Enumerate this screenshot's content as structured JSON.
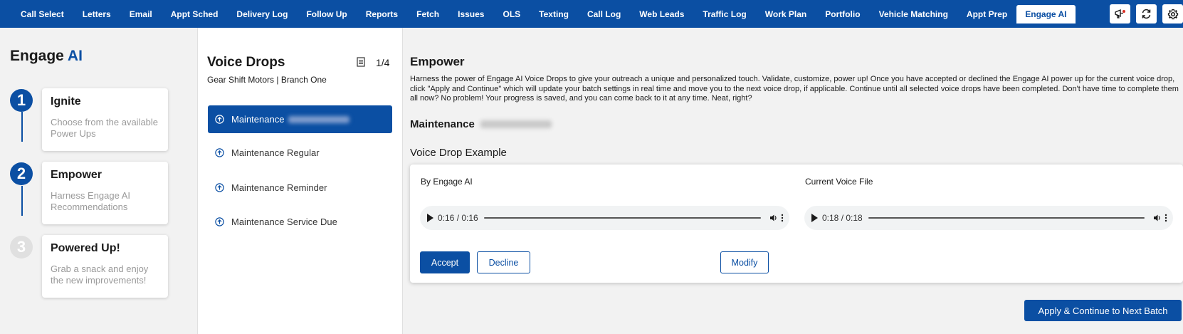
{
  "nav": {
    "tabs": [
      "Call Select",
      "Letters",
      "Email",
      "Appt Sched",
      "Delivery Log",
      "Follow Up",
      "Reports",
      "Fetch",
      "Issues",
      "OLS",
      "Texting",
      "Call Log",
      "Web Leads",
      "Traffic Log",
      "Work Plan",
      "Portfolio",
      "Vehicle Matching",
      "Appt Prep",
      "Engage AI"
    ],
    "active_tab": "Engage AI",
    "icons": [
      "megaphone-icon",
      "refresh-icon",
      "gear-icon"
    ]
  },
  "sidebar": {
    "brand_prefix": "Engage",
    "brand_suffix": "AI",
    "steps": [
      {
        "number": "1",
        "title": "Ignite",
        "description": "Choose from the available Power Ups",
        "state": "complete"
      },
      {
        "number": "2",
        "title": "Empower",
        "description": "Harness Engage AI Recommendations",
        "state": "current"
      },
      {
        "number": "3",
        "title": "Powered Up!",
        "description": "Grab a snack and enjoy the new improvements!",
        "state": "pending"
      }
    ]
  },
  "voice_drops": {
    "title": "Voice Drops",
    "count": "1/4",
    "subtitle": "Gear Shift Motors | Branch One",
    "items": [
      {
        "label": "Maintenance",
        "active": true,
        "redacted": true
      },
      {
        "label": "Maintenance Regular",
        "active": false,
        "redacted": false
      },
      {
        "label": "Maintenance Reminder",
        "active": false,
        "redacted": false
      },
      {
        "label": "Maintenance Service Due",
        "active": false,
        "redacted": false
      }
    ]
  },
  "empower": {
    "title": "Empower",
    "description": "Harness the power of Engage AI Voice Drops to give your outreach a unique and personalized touch. Validate, customize, power up! Once you have accepted or declined the Engage AI power up for the current voice drop, click \"Apply and Continue\" which will update your batch settings in real time and move you to the next voice drop, if applicable. Continue until all selected voice drops have been completed. Don't have time to complete them all now? No problem! Your progress is saved, and you can come back to it at any time. Neat, right?",
    "selected_title": "Maintenance",
    "example_title": "Voice Drop Example",
    "engage_label": "By Engage AI",
    "engage_time": "0:16 / 0:16",
    "current_label": "Current Voice File",
    "current_time": "0:18 / 0:18",
    "accept_label": "Accept",
    "decline_label": "Decline",
    "modify_label": "Modify",
    "apply_label": "Apply & Continue to Next Batch"
  },
  "colors": {
    "brand": "#0b4fa3",
    "inactive_step": "#e0e0e0"
  }
}
